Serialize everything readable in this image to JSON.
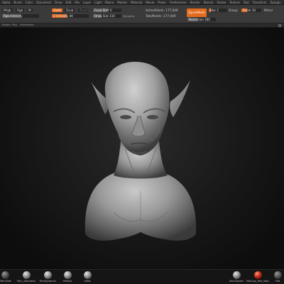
{
  "menu": [
    "Alpha",
    "Brush",
    "Color",
    "Document",
    "Draw",
    "Edit",
    "File",
    "Layer",
    "Light",
    "Macro",
    "Marker",
    "Material",
    "Movie",
    "Picker",
    "Preferences",
    "Render",
    "Stencil",
    "Stroke",
    "Texture",
    "Tool",
    "Transform",
    "Zplugin",
    "Zscript"
  ],
  "shelf": {
    "rgb_label": "Mrgb",
    "rgb2_label": "Rgb",
    "m_label": "M",
    "zadd_label": "Zadd",
    "zsub_label": "Zsub",
    "zcut_label": "Zcut",
    "rgb_intensity_label": "Rgb Intensity",
    "z_intensity_label": "Z Intensity 40",
    "focal_shift_label": "Focal Shift 0",
    "draw_size_label": "Draw Size 110",
    "dynamic_label": "Dynamic",
    "active_points_label": "ActivePoints: 177,049",
    "total_points_label": "TotalPoints: 177,049",
    "dynamesh_label": "DynaMesh",
    "blur_label": "Blur 2",
    "resolution_label": "Resolution 180",
    "group_label": "Group",
    "polish_label": "Polish 10",
    "mirror_label": "Mirror",
    "rotate_label": "Rotate",
    "poly_label": "Poly",
    "interpolate_label": "Interpolate",
    "rgb_intensity_fill": 0.5,
    "z_intensity_fill": 0.4,
    "focal_fill": 0.5,
    "draw_size_fill": 0.3,
    "blur_fill": 0.1,
    "resolution_fill": 0.35,
    "polish_fill": 0.3
  },
  "viewport": {
    "model": "bust-sculpt"
  },
  "bottom_tools": [
    {
      "label": "ZRemSoft",
      "style": "dark"
    },
    {
      "label": "Pain_Standard",
      "style": "gray"
    },
    {
      "label": "TrimDynamic",
      "style": "gray"
    },
    {
      "label": "hPolish",
      "style": "gray"
    },
    {
      "label": "Inflat",
      "style": "gray"
    },
    {
      "label": "SkinShader",
      "style": "gray"
    },
    {
      "label": "MatCap_Red_Wax",
      "style": "red"
    },
    {
      "label": "Flat",
      "style": "dark"
    }
  ]
}
